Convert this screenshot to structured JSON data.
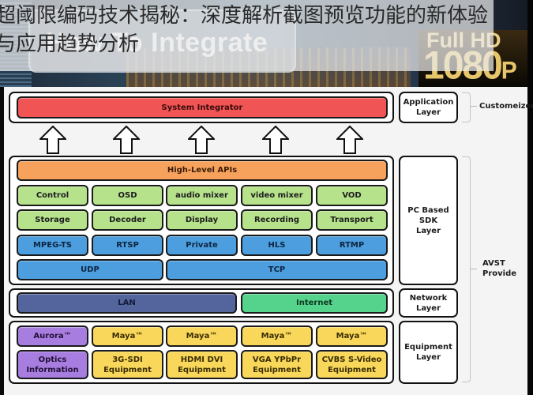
{
  "banner": {
    "headline": "How To Integrate",
    "hd_top": "Full HD",
    "hd_number": "1080",
    "hd_suffix": "P"
  },
  "overlay_title": "超阈限编码技术揭秘：深度解析截图预览功能的新体验与应用趋势分析",
  "diagram": {
    "application": {
      "system_integrator": "System Integrator",
      "layer_label": "Application\nLayer",
      "side_label": "Customeized"
    },
    "arrows": [
      "up-arrow",
      "up-arrow",
      "up-arrow",
      "up-arrow",
      "up-arrow"
    ],
    "sdk": {
      "high_level": "High-Level APIs",
      "row1": [
        "Control",
        "OSD",
        "audio mixer",
        "video mixer",
        "VOD"
      ],
      "row2": [
        "Storage",
        "Decoder",
        "Display",
        "Recording",
        "Transport"
      ],
      "row3": [
        "MPEG-TS",
        "RTSP",
        "Private",
        "HLS",
        "RTMP"
      ],
      "row4": [
        "UDP",
        "TCP"
      ],
      "layer_label": "PC Based\nSDK\nLayer"
    },
    "network": {
      "blocks": [
        "LAN",
        "Internet"
      ],
      "layer_label": "Network\nLayer"
    },
    "equipment": {
      "row1": [
        "Aurora™",
        "Maya™",
        "Maya™",
        "Maya™",
        "Maya™"
      ],
      "row2": [
        "Optics\nInformation",
        "3G-SDI\nEquipment",
        "HDMI DVI\nEquipment",
        "VGA YPbPr\nEquipment",
        "CVBS S-Video\nEquipment"
      ],
      "layer_label": "Equipment\nLayer"
    },
    "provider_label": "AVST\nProvide"
  },
  "colors": {
    "system_integrator": "#f05454",
    "high_level_apis": "#f6a25d",
    "api_modules": "#b6e28c",
    "protocols": "#4c9ede",
    "lan": "#53659c",
    "internet": "#55d38d",
    "aurora": "#a77ee0",
    "maya": "#f8d75a"
  }
}
